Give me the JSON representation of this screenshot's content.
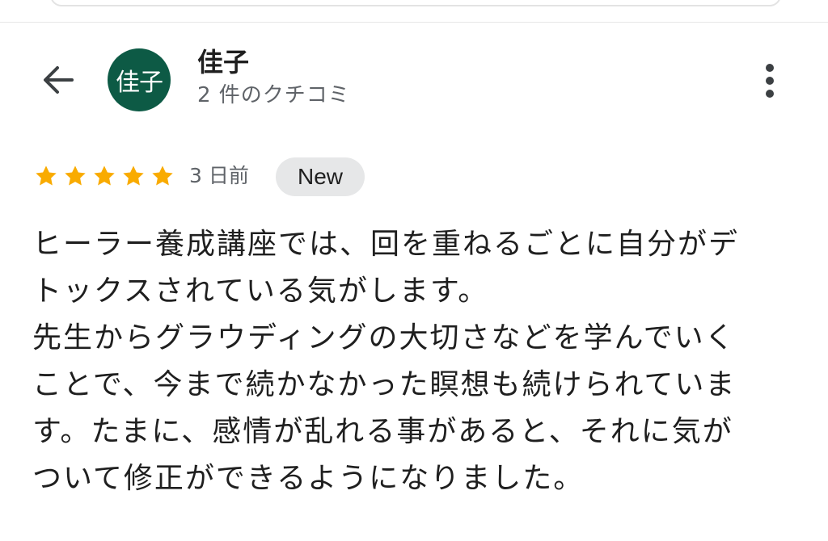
{
  "header": {
    "reviewer_name": "佳子",
    "avatar_text": "佳子",
    "review_count": "2 件のクチコミ"
  },
  "review": {
    "rating": 5,
    "max_rating": 5,
    "date": "3 日前",
    "badge": "New",
    "lines": [
      "ヒーラー養成講座では、回を重ねるごとに自分がデ",
      "トックスされている気がします。",
      "先生からグラウディングの大切さなどを学んでいく",
      "ことで、今まで続かなかった瞑想も続けられていま",
      "す。たまに、感情が乱れる事があると、それに気が",
      "ついて修正ができるようになりました。"
    ]
  },
  "icons": {
    "back": "back-arrow-icon",
    "more": "more-vert-icon",
    "star": "star-icon"
  },
  "colors": {
    "avatar_bg": "#0d5a45",
    "star": "#f9ab00",
    "badge_bg": "#e6e7e8",
    "text": "#1f1f1f",
    "secondary_text": "#5f6368"
  }
}
